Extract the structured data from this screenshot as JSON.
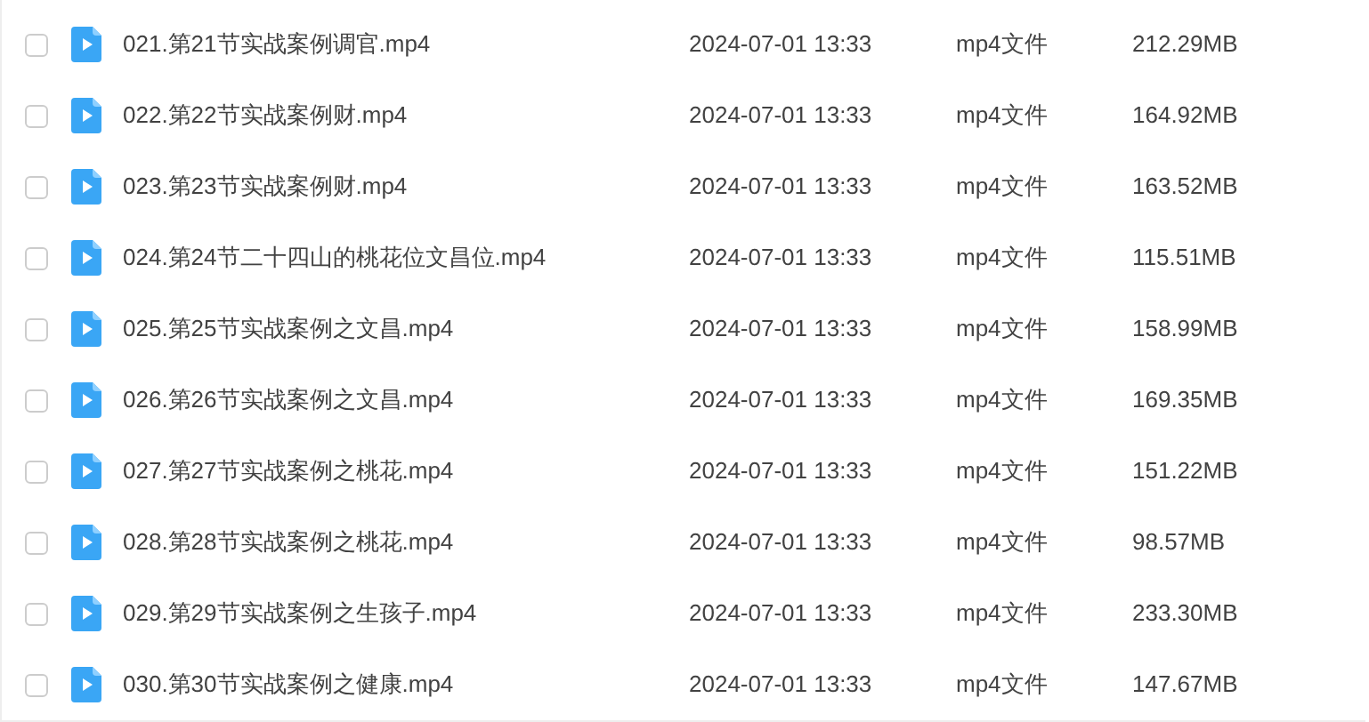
{
  "files": [
    {
      "name": "021.第21节实战案例调官.mp4",
      "modified": "2024-07-01 13:33",
      "type": "mp4文件",
      "size": "212.29MB",
      "checked": false
    },
    {
      "name": "022.第22节实战案例财.mp4",
      "modified": "2024-07-01 13:33",
      "type": "mp4文件",
      "size": "164.92MB",
      "checked": false
    },
    {
      "name": "023.第23节实战案例财.mp4",
      "modified": "2024-07-01 13:33",
      "type": "mp4文件",
      "size": "163.52MB",
      "checked": false
    },
    {
      "name": "024.第24节二十四山的桃花位文昌位.mp4",
      "modified": "2024-07-01 13:33",
      "type": "mp4文件",
      "size": "115.51MB",
      "checked": false
    },
    {
      "name": "025.第25节实战案例之文昌.mp4",
      "modified": "2024-07-01 13:33",
      "type": "mp4文件",
      "size": "158.99MB",
      "checked": false
    },
    {
      "name": "026.第26节实战案例之文昌.mp4",
      "modified": "2024-07-01 13:33",
      "type": "mp4文件",
      "size": "169.35MB",
      "checked": false
    },
    {
      "name": "027.第27节实战案例之桃花.mp4",
      "modified": "2024-07-01 13:33",
      "type": "mp4文件",
      "size": "151.22MB",
      "checked": false
    },
    {
      "name": "028.第28节实战案例之桃花.mp4",
      "modified": "2024-07-01 13:33",
      "type": "mp4文件",
      "size": "98.57MB",
      "checked": false
    },
    {
      "name": "029.第29节实战案例之生孩子.mp4",
      "modified": "2024-07-01 13:33",
      "type": "mp4文件",
      "size": "233.30MB",
      "checked": false
    },
    {
      "name": "030.第30节实战案例之健康.mp4",
      "modified": "2024-07-01 13:33",
      "type": "mp4文件",
      "size": "147.67MB",
      "checked": false
    }
  ]
}
